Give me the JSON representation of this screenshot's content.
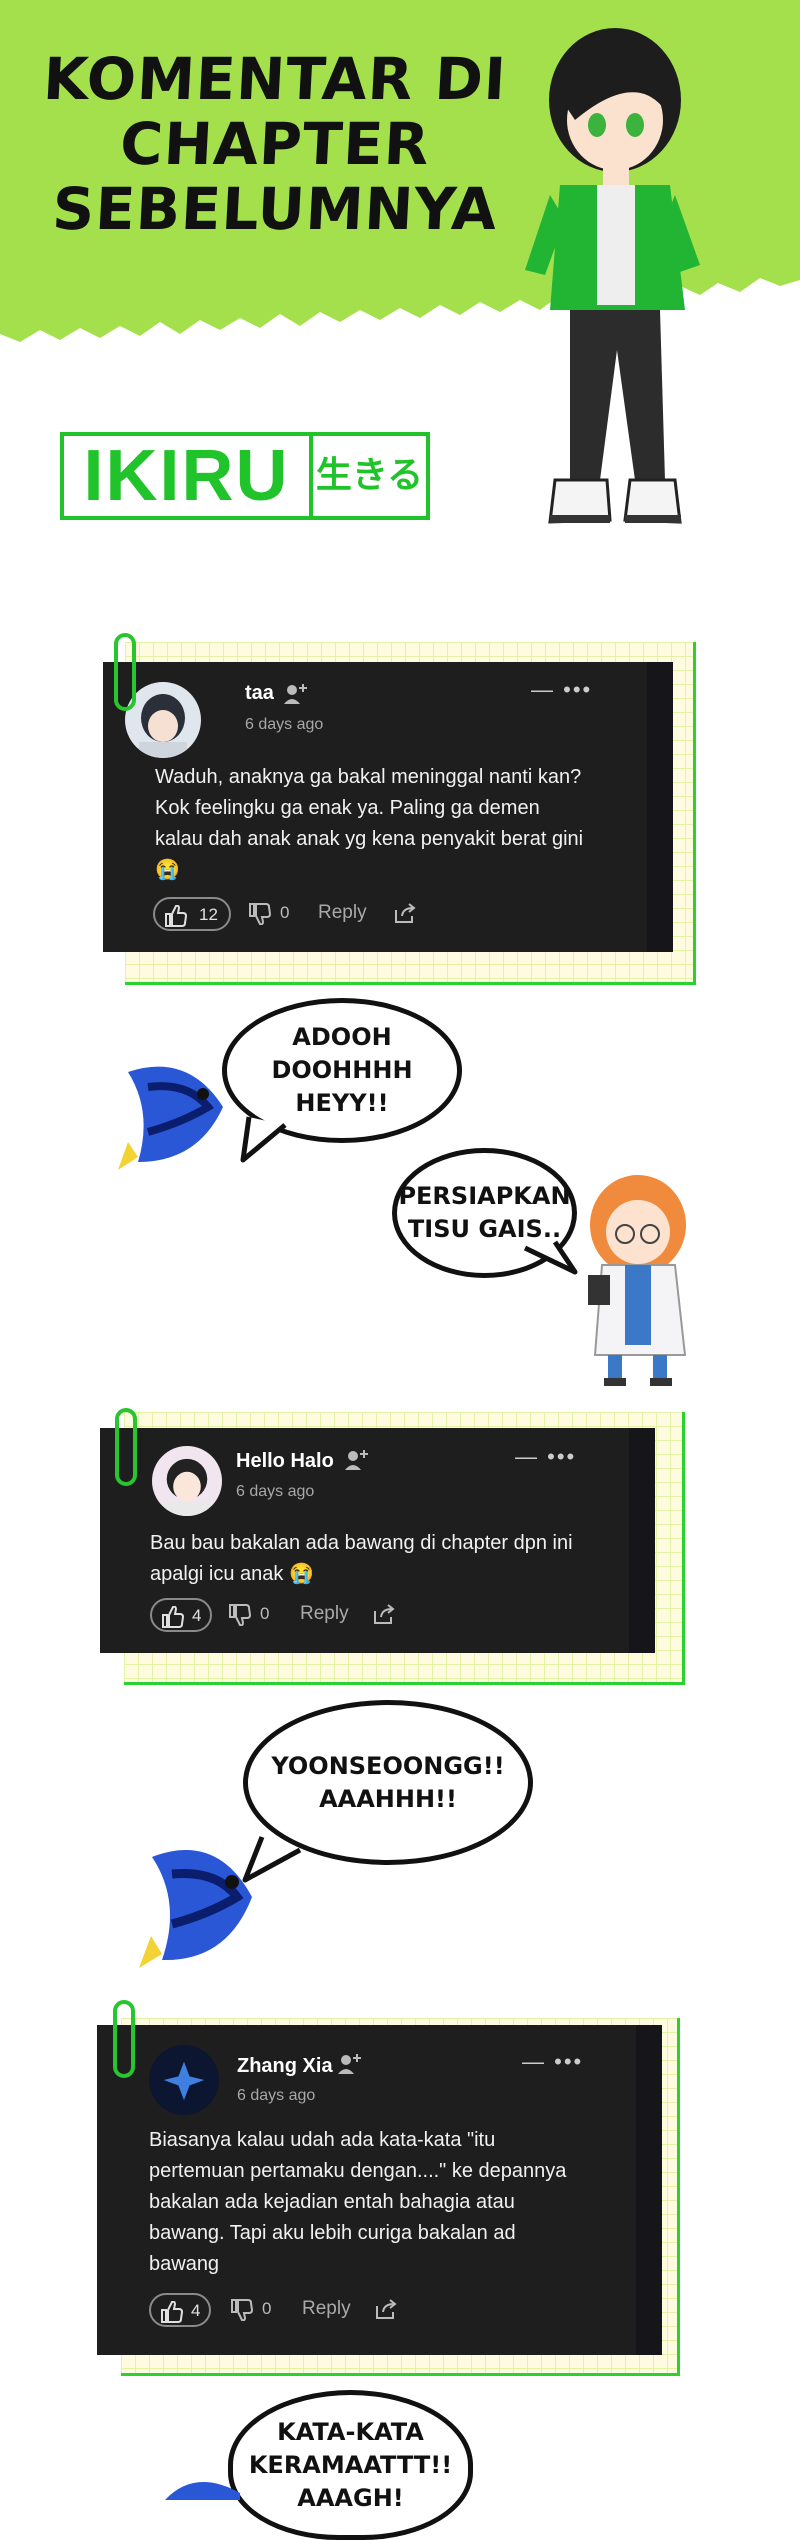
{
  "header": {
    "title_lines": [
      "KOMENTAR DI",
      "CHAPTER",
      "SEBELUMNYA"
    ],
    "logo_main": "IKIRU",
    "logo_sub": "生きる"
  },
  "comments": [
    {
      "username": "taa",
      "time": "6 days ago",
      "menu": "— •••",
      "lines": [
        "Waduh, anaknya ga bakal meninggal nanti kan?",
        "Kok feelingku ga enak ya. Paling ga demen",
        "kalau dah anak anak yg kena penyakit berat gini",
        "😭"
      ],
      "likes": "12",
      "dislikes": "0",
      "reply": "Reply"
    },
    {
      "username": "Hello Halo",
      "time": "6 days ago",
      "menu": "— •••",
      "lines": [
        "Bau bau bakalan ada bawang di chapter dpn ini",
        "apalgi icu anak 😭"
      ],
      "likes": "4",
      "dislikes": "0",
      "reply": "Reply"
    },
    {
      "username": "Zhang Xia",
      "time": "6 days ago",
      "menu": "— •••",
      "lines": [
        "Biasanya kalau udah ada kata-kata \"itu",
        "pertemuan pertamaku dengan....\" ke depannya",
        "bakalan ada kejadian entah bahagia atau",
        "bawang. Tapi aku lebih curiga bakalan ad",
        "bawang"
      ],
      "likes": "4",
      "dislikes": "0",
      "reply": "Reply"
    }
  ],
  "bubbles": [
    "ADOOH\nDOOHHHH\nHEYY!!",
    "PERSIAPKAN\nTISU GAIS..",
    "YOONSEOONGG!!\nAAAHHH!!",
    "KATA-KATA\nKERAMAATTT!!\nAAAGH!"
  ],
  "colors": {
    "accent_green": "#20c32a",
    "banner_green": "#a4e04c",
    "card_bg": "#1e1e1e"
  }
}
